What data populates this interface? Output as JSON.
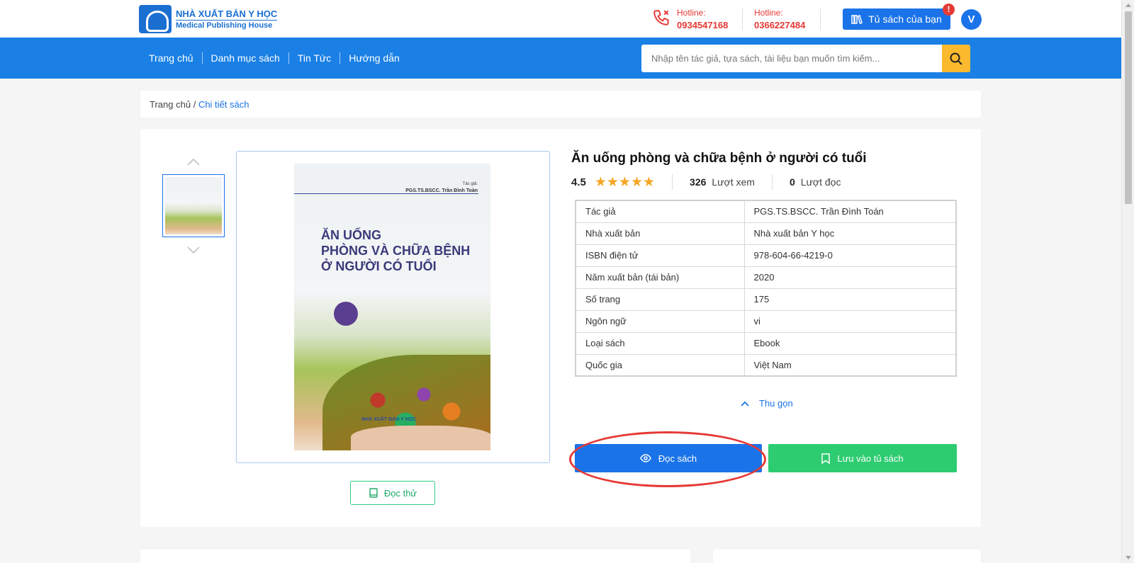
{
  "header": {
    "logo_line1": "NHÀ XUẤT BẢN Y HỌC",
    "logo_line2": "Medical Publishing House",
    "hotline1_label": "Hotline:",
    "hotline1_number": "0934547168",
    "hotline2_label": "Hotline:",
    "hotline2_number": "0366227484",
    "shelf_button": "Tủ sách của bạn",
    "shelf_badge": "!",
    "avatar_letter": "V"
  },
  "nav": {
    "items": [
      "Trang chủ",
      "Danh mục sách",
      "Tin Tức",
      "Hướng dẫn"
    ]
  },
  "search": {
    "placeholder": "Nhập tên tác giả, tựa sách, tài liệu bạn muốn tìm kiếm...",
    "icon": "search-icon"
  },
  "breadcrumb": {
    "home": "Trang chủ",
    "separator": "/",
    "current": "Chi tiết sách"
  },
  "cover": {
    "author_label": "Tác giả:",
    "author": "PGS.TS.BSCC. Trần Đình Toàn",
    "title_l1": "ĂN UỐNG",
    "title_l2": "PHÒNG VÀ CHỮA BỆNH",
    "title_l3": "Ở NGƯỜI CÓ TUỔI",
    "publisher": "NHÀ XUẤT BẢN Y HỌC"
  },
  "book": {
    "title": "Ăn uống phòng và chữa bệnh ở người có tuổi",
    "rating": "4.5",
    "stars": 5,
    "views_count": "326",
    "views_label": "Lượt xem",
    "reads_count": "0",
    "reads_label": "Lượt đọc",
    "details": [
      {
        "label": "Tác giả",
        "value": "PGS.TS.BSCC. Trần Đình Toán"
      },
      {
        "label": "Nhà xuất bản",
        "value": "Nhà xuất bản Y học"
      },
      {
        "label": "ISBN điện tử",
        "value": "978-604-66-4219-0"
      },
      {
        "label": "Năm xuất bản (tái bản)",
        "value": "2020"
      },
      {
        "label": "Số trang",
        "value": "175"
      },
      {
        "label": "Ngôn ngữ",
        "value": "vi"
      },
      {
        "label": "Loại sách",
        "value": "Ebook"
      },
      {
        "label": "Quốc gia",
        "value": "Việt Nam"
      }
    ]
  },
  "actions": {
    "collapse": "Thu gọn",
    "read": "Đọc sách",
    "save": "Lưu vào tủ sách",
    "try_read": "Đọc thử"
  },
  "colors": {
    "primary": "#1a73e8",
    "nav_bg": "#1a80e5",
    "search_btn": "#fbb92e",
    "hotline": "#e53935",
    "save_green": "#2ecc71",
    "star": "#f5a623",
    "highlight": "#e53935"
  }
}
